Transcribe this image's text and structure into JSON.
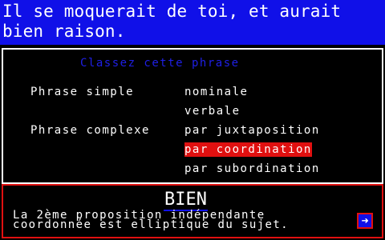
{
  "sentence": {
    "text": "Il se moquerait de toi, et aurait bien raison."
  },
  "classify": {
    "title": "Classez cette phrase",
    "simple_label": "Phrase simple",
    "complex_label": "Phrase complexe",
    "options": [
      "nominale",
      "verbale",
      "par juxtaposition",
      "par coordination",
      "par subordination"
    ],
    "selected": "par coordination"
  },
  "feedback": {
    "verdict": "BIEN",
    "explanation_line1": "La 2ème proposition indépendante",
    "explanation_line2": "coordonnée est elliptique du sujet.",
    "next_icon": "right-arrow-icon",
    "next_glyph": "➜"
  },
  "colors": {
    "banner_blue": "#1010e8",
    "selection_red": "#e01010",
    "text_white": "#ffffff"
  }
}
